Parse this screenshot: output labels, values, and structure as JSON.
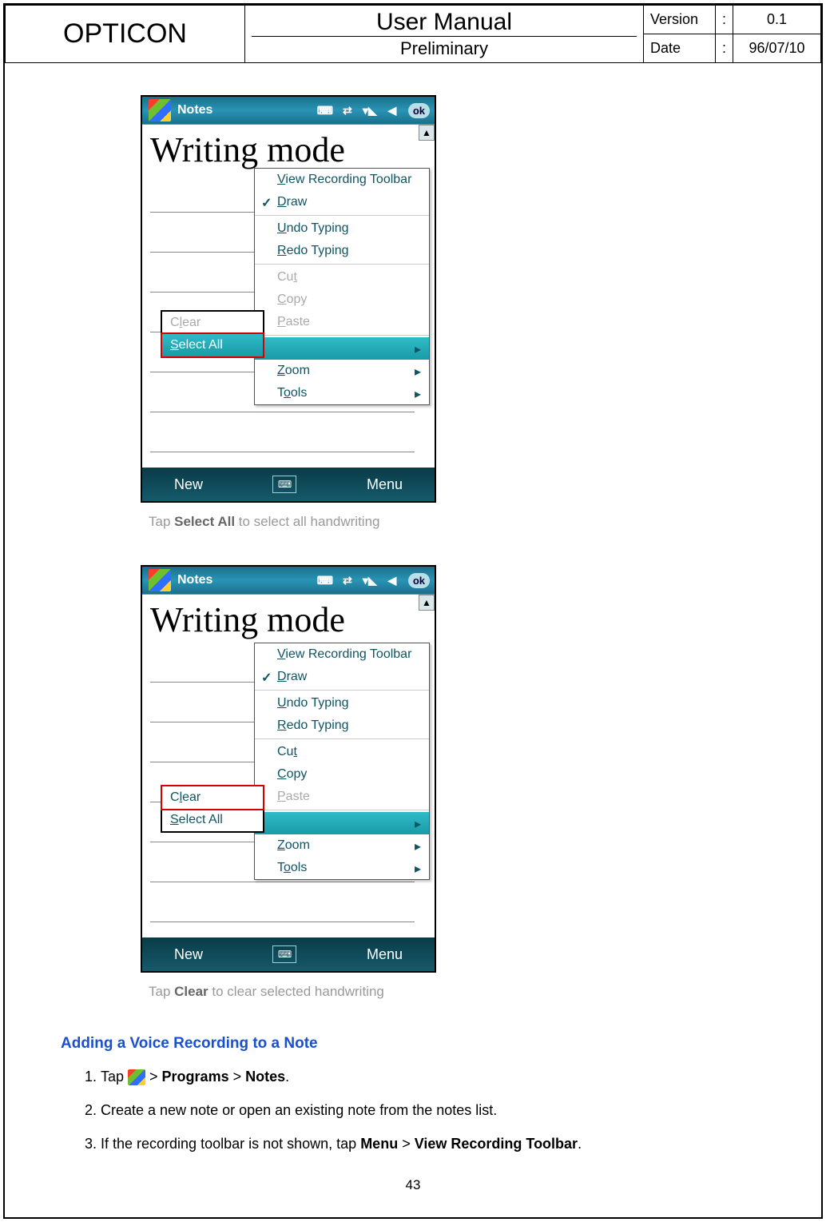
{
  "header": {
    "brand": "OPTICON",
    "title": "User Manual",
    "subtitle": "Preliminary",
    "version_label": "Version",
    "version_value": "0.1",
    "date_label": "Date",
    "date_value": "96/07/10",
    "colon": ":"
  },
  "screenshot1": {
    "app_title": "Notes",
    "ok": "ok",
    "handwriting": "Writing mode",
    "menu": {
      "view_recording_toolbar": "View Recording Toolbar",
      "draw": "Draw",
      "undo": "Undo Typing",
      "redo": "Redo Typing",
      "cut": "Cut",
      "copy": "Copy",
      "paste": "Paste",
      "zoom": "Zoom",
      "tools": "Tools"
    },
    "submenu": {
      "clear": "Clear",
      "select_all": "Select All"
    },
    "soft_new": "New",
    "soft_menu": "Menu",
    "caption_pre": "Tap ",
    "caption_bold": "Select All",
    "caption_post": " to select all handwriting"
  },
  "screenshot2": {
    "app_title": "Notes",
    "ok": "ok",
    "handwriting": "Writing mode",
    "menu": {
      "view_recording_toolbar": "View Recording Toolbar",
      "draw": "Draw",
      "undo": "Undo Typing",
      "redo": "Redo Typing",
      "cut": "Cut",
      "copy": "Copy",
      "paste": "Paste",
      "zoom": "Zoom",
      "tools": "Tools"
    },
    "submenu": {
      "clear": "Clear",
      "select_all": "Select All"
    },
    "soft_new": "New",
    "soft_menu": "Menu",
    "caption_pre": "Tap ",
    "caption_bold": "Clear",
    "caption_post": " to clear selected handwriting"
  },
  "section": {
    "title": "Adding a Voice Recording to a Note",
    "step1_pre": "Tap ",
    "step1_post1": " > ",
    "step1_programs": "Programs",
    "step1_post2": " > ",
    "step1_notes": "Notes",
    "step1_end": ".",
    "step2": "Create a new note or open an existing note from the notes list.",
    "step3_pre": "If the recording toolbar is not shown, tap ",
    "step3_menu": "Menu",
    "step3_mid": " > ",
    "step3_vrt": "View Recording Toolbar",
    "step3_end": "."
  },
  "page_number": "43"
}
